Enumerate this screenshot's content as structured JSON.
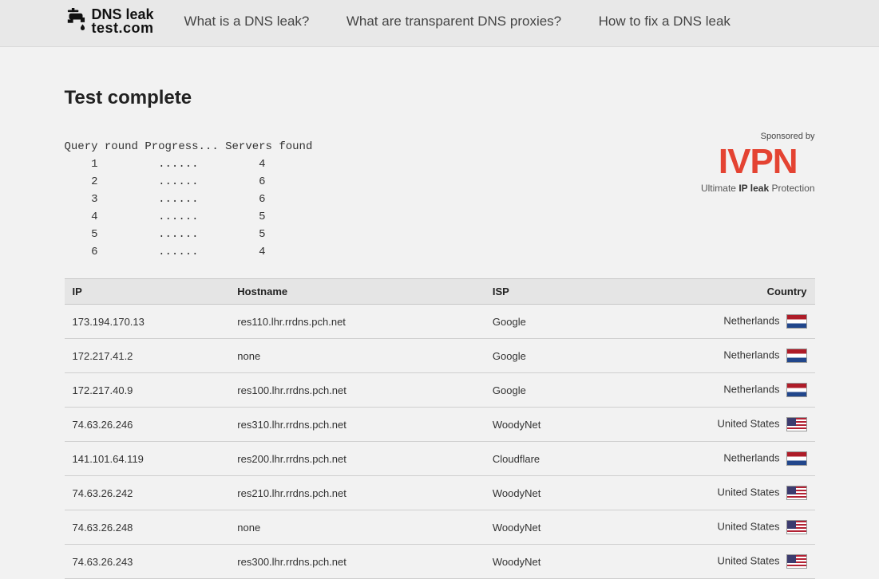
{
  "brand": {
    "line1": "DNS leak",
    "line2": "test.com"
  },
  "nav": [
    "What is a DNS leak?",
    "What are transparent DNS proxies?",
    "How to fix a DNS leak"
  ],
  "title": "Test complete",
  "progress": {
    "header": "Query round Progress... Servers found",
    "rows": [
      {
        "round": "1",
        "dots": "......",
        "found": "4"
      },
      {
        "round": "2",
        "dots": "......",
        "found": "6"
      },
      {
        "round": "3",
        "dots": "......",
        "found": "6"
      },
      {
        "round": "4",
        "dots": "......",
        "found": "5"
      },
      {
        "round": "5",
        "dots": "......",
        "found": "5"
      },
      {
        "round": "6",
        "dots": "......",
        "found": "4"
      }
    ]
  },
  "sponsor": {
    "label": "Sponsored by",
    "logo": "IVPN",
    "tag_pre": "Ultimate ",
    "tag_bold": "IP leak",
    "tag_post": " Protection"
  },
  "columns": {
    "ip": "IP",
    "hostname": "Hostname",
    "isp": "ISP",
    "country": "Country"
  },
  "rows": [
    {
      "ip": "173.194.170.13",
      "hostname": "res110.lhr.rrdns.pch.net",
      "isp": "Google",
      "country": "Netherlands",
      "flag": "nl"
    },
    {
      "ip": "172.217.41.2",
      "hostname": "none",
      "isp": "Google",
      "country": "Netherlands",
      "flag": "nl"
    },
    {
      "ip": "172.217.40.9",
      "hostname": "res100.lhr.rrdns.pch.net",
      "isp": "Google",
      "country": "Netherlands",
      "flag": "nl"
    },
    {
      "ip": "74.63.26.246",
      "hostname": "res310.lhr.rrdns.pch.net",
      "isp": "WoodyNet",
      "country": "United States",
      "flag": "us"
    },
    {
      "ip": "141.101.64.119",
      "hostname": "res200.lhr.rrdns.pch.net",
      "isp": "Cloudflare",
      "country": "Netherlands",
      "flag": "nl"
    },
    {
      "ip": "74.63.26.242",
      "hostname": "res210.lhr.rrdns.pch.net",
      "isp": "WoodyNet",
      "country": "United States",
      "flag": "us"
    },
    {
      "ip": "74.63.26.248",
      "hostname": "none",
      "isp": "WoodyNet",
      "country": "United States",
      "flag": "us"
    },
    {
      "ip": "74.63.26.243",
      "hostname": "res300.lhr.rrdns.pch.net",
      "isp": "WoodyNet",
      "country": "United States",
      "flag": "us"
    }
  ]
}
